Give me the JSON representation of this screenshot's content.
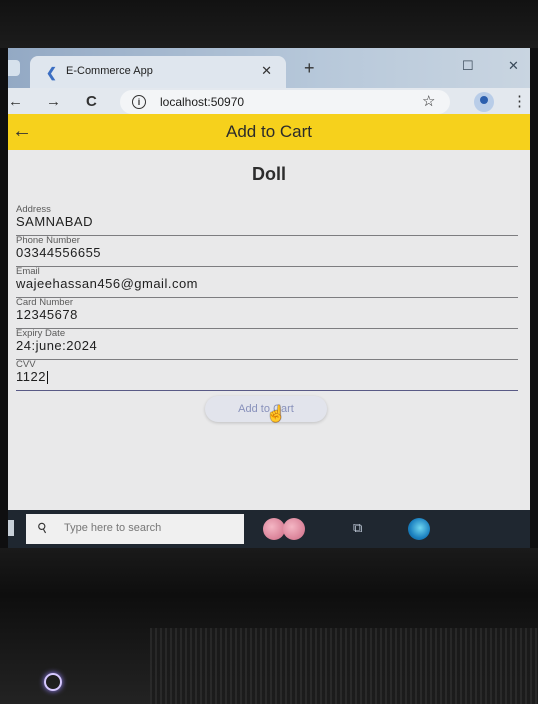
{
  "browser": {
    "tab_title": "E-Commerce App",
    "url": "localhost:50970"
  },
  "appbar": {
    "title": "Add to Cart"
  },
  "product": {
    "name": "Doll"
  },
  "form": {
    "fields": [
      {
        "label": "Address",
        "value": "SAMNABAD"
      },
      {
        "label": "Phone Number",
        "value": "03344556655"
      },
      {
        "label": "Email",
        "value": "wajeehassan456@gmail.com"
      },
      {
        "label": "Card Number",
        "value": "12345678"
      },
      {
        "label": "Expiry Date",
        "value": "24:june:2024"
      },
      {
        "label": "CVV",
        "value": "1122"
      }
    ],
    "submit_label": "Add to Cart"
  },
  "taskbar": {
    "search_placeholder": "Type here to search"
  },
  "colors": {
    "appbar": "#f6d11c",
    "button_text": "#8891bb"
  },
  "icons": [
    "back-arrow-icon",
    "reload-icon",
    "star-icon",
    "profile-icon",
    "search-icon",
    "edge-icon",
    "task-view-icon",
    "power-icon"
  ]
}
